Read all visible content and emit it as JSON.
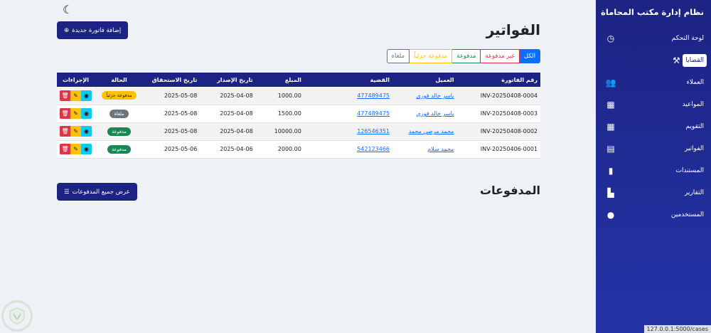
{
  "brand": "نظام إدارة مكتب المحاماة",
  "nav": [
    {
      "label": "لوحة التحكم",
      "icon": "dashboard-icon",
      "glyph": "◷",
      "active": false
    },
    {
      "label": "القضايا",
      "icon": "gavel-icon",
      "glyph": "⚒",
      "active": true
    },
    {
      "label": "العملاء",
      "icon": "users-icon",
      "glyph": "👥",
      "active": false
    },
    {
      "label": "المواعيد",
      "icon": "calendar-icon",
      "glyph": "▦",
      "active": false
    },
    {
      "label": "التقويم",
      "icon": "calendar-grid-icon",
      "glyph": "▦",
      "active": false
    },
    {
      "label": "الفواتير",
      "icon": "invoice-icon",
      "glyph": "▤",
      "active": false
    },
    {
      "label": "المستندات",
      "icon": "document-icon",
      "glyph": "▮",
      "active": false
    },
    {
      "label": "التقارير",
      "icon": "chart-icon",
      "glyph": "▙",
      "active": false
    },
    {
      "label": "المستخدمين",
      "icon": "user-gear-icon",
      "glyph": "●",
      "active": false
    }
  ],
  "url_hint": "127.0.0.1:5000/cases",
  "page": {
    "title": "الفواتير",
    "add_button": "إضافة فاتورة جديدة",
    "filters": {
      "all": "الكل",
      "unpaid": "غير مدفوعة",
      "paid": "مدفوعة",
      "partial": "مدفوعة جزئياً",
      "cancelled": "ملغاة"
    }
  },
  "table": {
    "headers": {
      "number": "رقم الفاتورة",
      "client": "العميل",
      "case": "القضية",
      "amount": "المبلغ",
      "issue": "تاريخ الإصدار",
      "due": "تاريخ الاستحقاق",
      "status": "الحالة",
      "actions": "الإجراءات"
    },
    "rows": [
      {
        "number": "INV-20250408-0004",
        "client": "ياسر خالد فوزي",
        "case": "477489475",
        "amount": "1000.00",
        "issue": "2025-04-08",
        "due": "2025-05-08",
        "status": "مدفوعة جزئياً",
        "status_type": "partial"
      },
      {
        "number": "INV-20250408-0003",
        "client": "ياسر خالد فوزي",
        "case": "477489475",
        "amount": "1500.00",
        "issue": "2025-04-08",
        "due": "2025-05-08",
        "status": "ملغاة",
        "status_type": "cancel"
      },
      {
        "number": "INV-20250408-0002",
        "client": "محمد مرضي محمد",
        "case": "126546351",
        "amount": "10000.00",
        "issue": "2025-04-08",
        "due": "2025-05-08",
        "status": "مدفوعة",
        "status_type": "paid"
      },
      {
        "number": "INV-20250406-0001",
        "client": "محمد سلام",
        "case": "542123466",
        "amount": "2000.00",
        "issue": "2025-04-06",
        "due": "2025-05-06",
        "status": "مدفوعة",
        "status_type": "paid"
      }
    ]
  },
  "payments": {
    "title": "المدفوعات",
    "view_all_button": "عرض جميع المدفوعات"
  }
}
